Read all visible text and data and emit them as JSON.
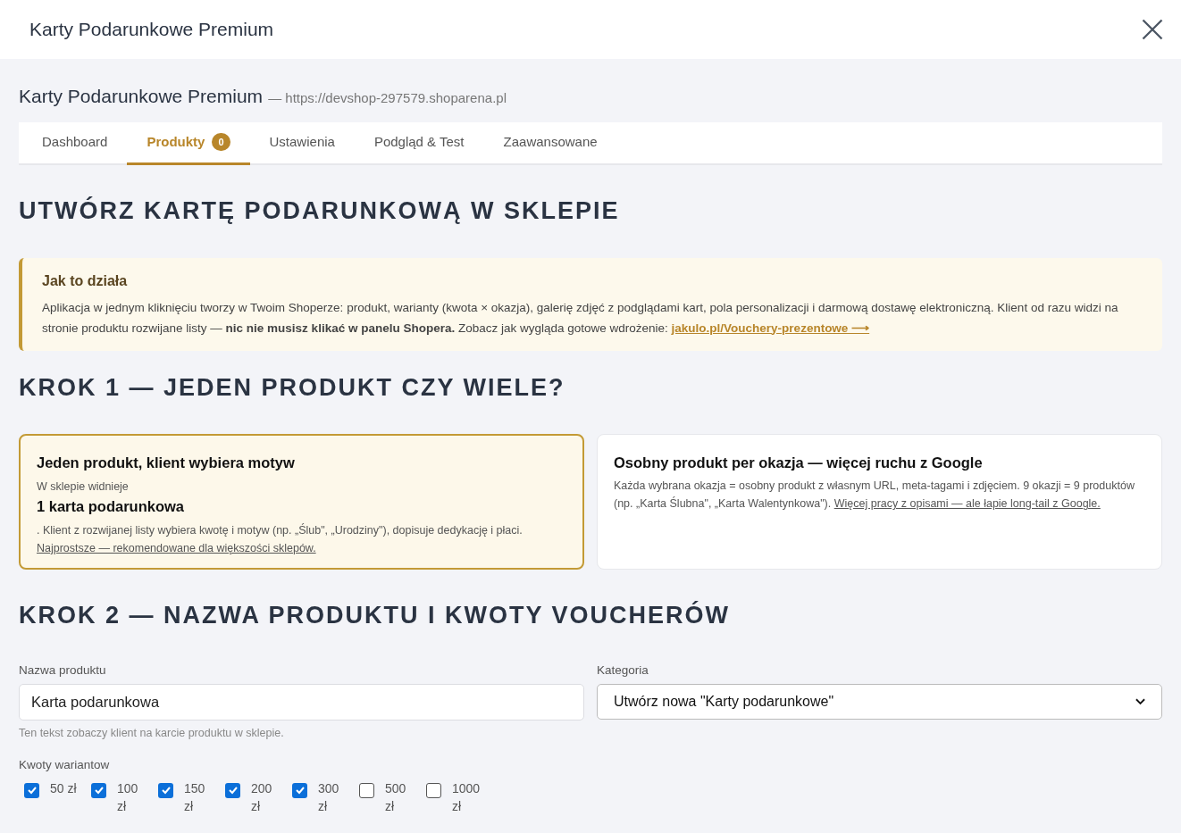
{
  "window": {
    "title": "Karty Podarunkowe Premium"
  },
  "app": {
    "name": "Karty Podarunkowe Premium",
    "url": "— https://devshop-297579.shoparena.pl"
  },
  "tabs": [
    {
      "label": "Dashboard",
      "selected": false
    },
    {
      "label": "Produkty",
      "selected": true,
      "badge": "0"
    },
    {
      "label": "Ustawienia",
      "selected": false
    },
    {
      "label": "Podgląd & Test",
      "selected": false
    },
    {
      "label": "Zaawansowane",
      "selected": false
    }
  ],
  "heading": "UTWÓRZ KARTĘ PODARUNKOWĄ W SKLEPIE",
  "info": {
    "title": "Jak to działa",
    "text": "Aplikacja w jednym kliknięciu tworzy w Twoim Shoperze: produkt, warianty (kwota × okazja), galerię zdjęć z podglądami kart, pola personalizacji i darmową dostawę elektroniczną. Klient od razu widzi na stronie produktu rozwijane listy — **nic nie musisz klikać w panelu Shopera.** Zobacz jak wygląda gotowe wdrożenie:",
    "link": "jakulo.pl/Vouchery-prezentowe ⟶"
  },
  "step1": {
    "heading": "KROK 1 — JEDEN PRODUKT CZY WIELE?",
    "options": [
      {
        "title": "Jeden produkt, klient wybiera motyw",
        "selected": true,
        "lead": "W sklepie widnieje",
        "emphasis": "1 karta podarunkowa",
        "text": ". Klient z rozwijanej listy wybiera kwotę i motyw (np. „Ślub\", „Urodziny\"), dopisuje dedykację i płaci.",
        "link": "Najprostsze — rekomendowane dla większości sklepów."
      },
      {
        "title": "Osobny produkt per okazja — więcej ruchu z Google",
        "selected": false,
        "text": "Każda wybrana okazja = osobny produkt z własnym URL, meta-tagami i zdjęciem. 9 okazji = 9 produktów (np. „Karta Ślubna\", „Karta Walentynkowa\").",
        "link": "Więcej pracy z opisami — ale łapie long-tail z Google."
      }
    ]
  },
  "step2": {
    "heading": "KROK 2 — NAZWA PRODUKTU I KWOTY VOUCHERÓW",
    "name_field": {
      "label": "Nazwa produktu",
      "value": "Karta podarunkowa",
      "hint": "Ten tekst zobaczy klient na karcie produktu w sklepie."
    },
    "category": {
      "label": "Kategoria",
      "value": "Utwórz nowa \"Karty podarunkowe\""
    },
    "amounts_label": "Kwoty wariantow",
    "amounts": [
      {
        "label": "50 zł",
        "checked": true
      },
      {
        "label": "100 zł",
        "checked": true
      },
      {
        "label": "150 zł",
        "checked": true
      },
      {
        "label": "200 zł",
        "checked": true
      },
      {
        "label": "300 zł",
        "checked": true
      },
      {
        "label": "500 zł",
        "checked": false
      },
      {
        "label": "1000 zł",
        "checked": false
      }
    ]
  }
}
